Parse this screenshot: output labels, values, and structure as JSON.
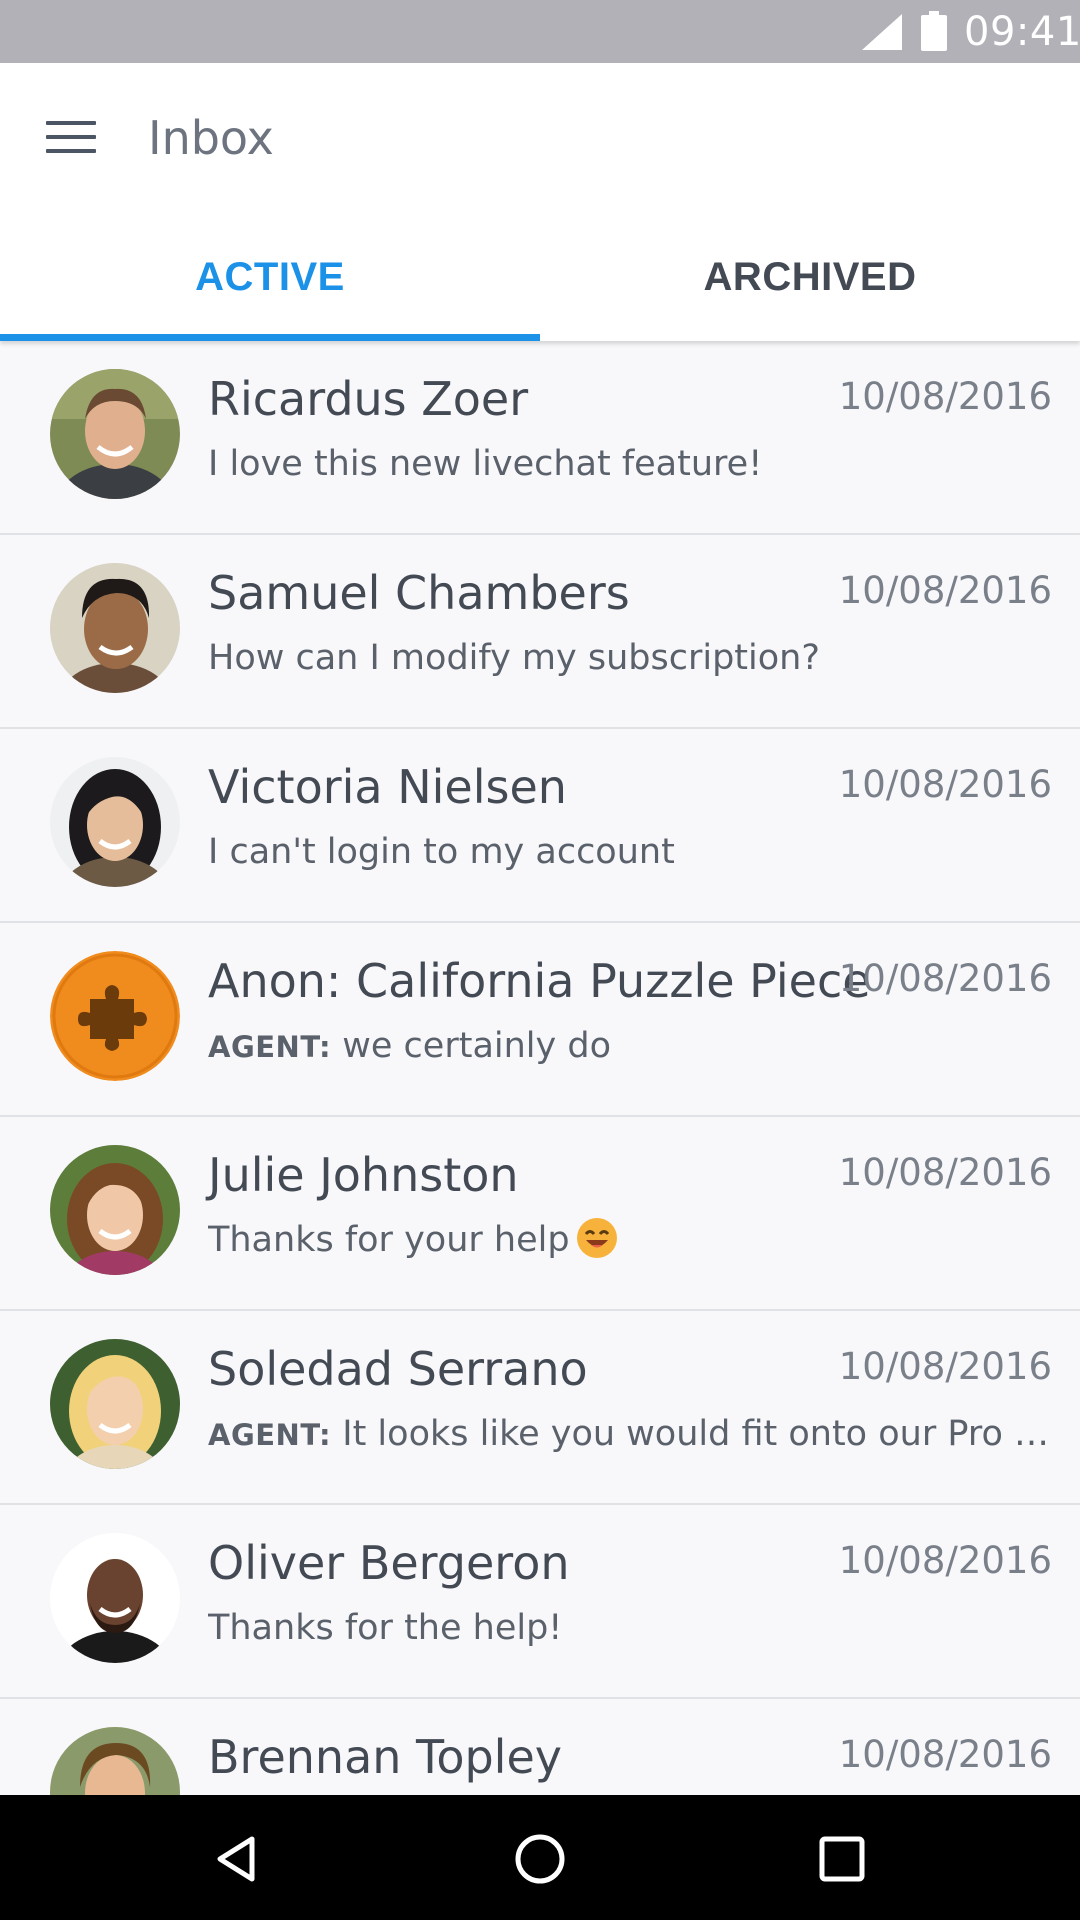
{
  "status_bar": {
    "time": "09:41",
    "icons": [
      "signal-icon",
      "battery-icon"
    ]
  },
  "app_bar": {
    "title": "Inbox",
    "menu_icon": "menu-icon"
  },
  "tabs": [
    {
      "label": "ACTIVE",
      "selected": true
    },
    {
      "label": "ARCHIVED",
      "selected": false
    }
  ],
  "colors": {
    "accent": "#1b92e8",
    "status_bar": "#b1b1b7",
    "text_primary": "#434a54",
    "anon_avatar": "#f08c1e"
  },
  "conversations": [
    {
      "name": "Ricardus Zoer",
      "date": "10/08/2016",
      "sender": "",
      "message": "I love this new livechat feature!",
      "avatar": "photo-avatar"
    },
    {
      "name": "Samuel Chambers",
      "date": "10/08/2016",
      "sender": "",
      "message": "How can I modify my subscription?",
      "avatar": "photo-avatar"
    },
    {
      "name": "Victoria Nielsen",
      "date": "10/08/2016",
      "sender": "",
      "message": "I can't login to my account",
      "avatar": "photo-avatar"
    },
    {
      "name": "Anon: California Puzzle Piece",
      "date": "10/08/2016",
      "sender": "AGENT:",
      "message": "we certainly do",
      "avatar": "puzzle-piece-icon"
    },
    {
      "name": "Julie Johnston",
      "date": "10/08/2016",
      "sender": "",
      "message": "Thanks for your help",
      "avatar": "photo-avatar",
      "emoji": "smiling-face-emoji"
    },
    {
      "name": "Soledad Serrano",
      "date": "10/08/2016",
      "sender": "AGENT:",
      "message": "It looks like you would fit onto our Pro plan...",
      "avatar": "photo-avatar"
    },
    {
      "name": "Oliver Bergeron",
      "date": "10/08/2016",
      "sender": "",
      "message": "Thanks for the help!",
      "avatar": "photo-avatar"
    },
    {
      "name": "Brennan Topley",
      "date": "10/08/2016",
      "sender": "",
      "message": "",
      "avatar": "photo-avatar"
    }
  ],
  "nav_bar": {
    "buttons": [
      "back-icon",
      "home-icon",
      "recents-icon"
    ]
  }
}
